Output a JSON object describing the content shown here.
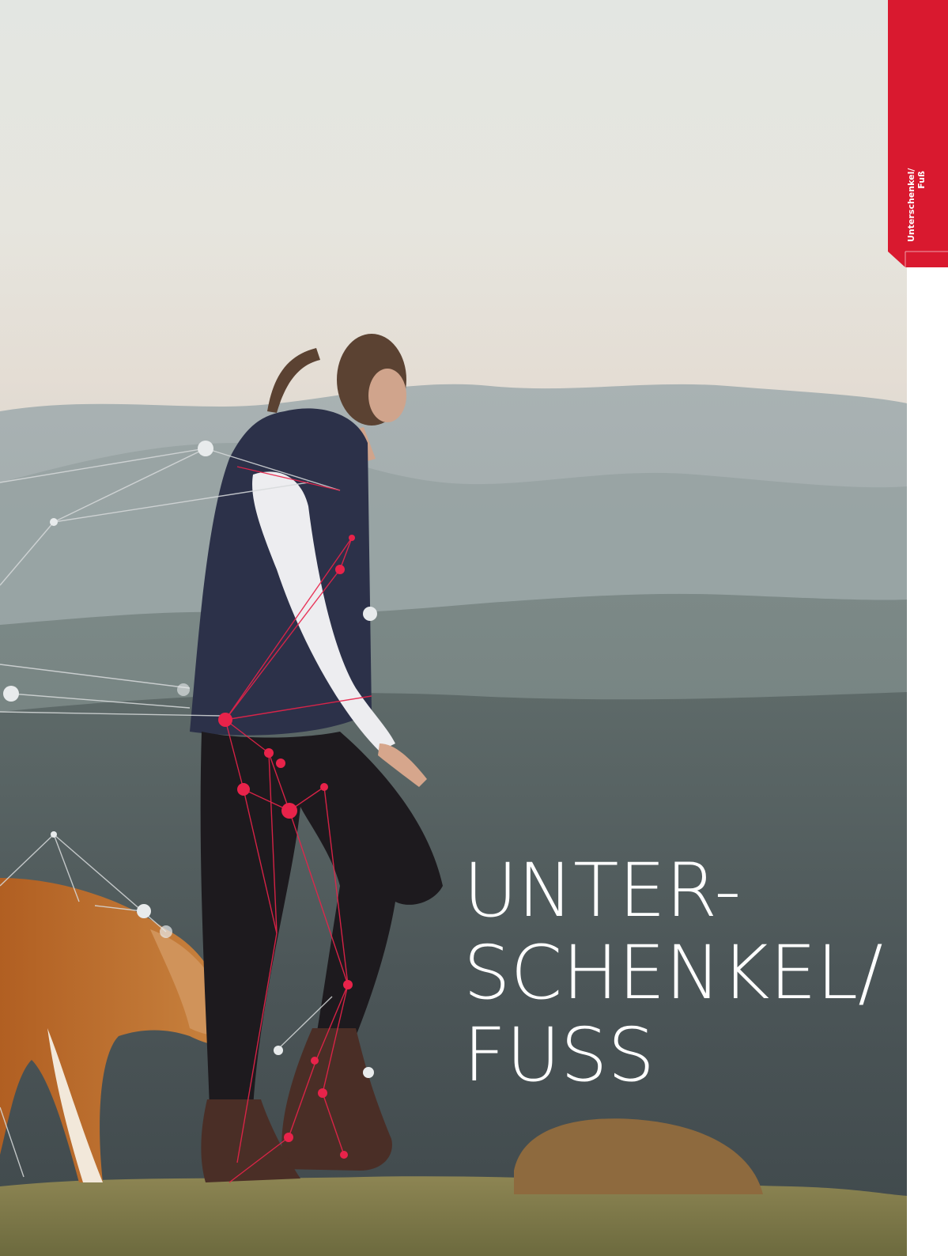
{
  "chapter_tab": {
    "line1": "Unterschenkel/",
    "line2": "Fuß",
    "color": "#D9192F"
  },
  "headline": {
    "line1": "UNTER-",
    "line2": "SCHENKEL/",
    "line3": "FUSS"
  },
  "photo": {
    "subject": "woman-and-dog-walking-on-hilltop",
    "accent_network_color": "#E8234A"
  }
}
